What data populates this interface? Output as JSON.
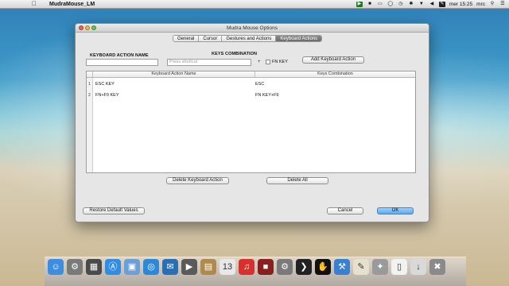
{
  "menubar": {
    "apple": "",
    "app_name": "MudraMouse_LM",
    "clock": "mer 15:25",
    "user": "mrc"
  },
  "window": {
    "title": "Mudra Mouse Options",
    "tabs": [
      {
        "label": "General",
        "active": false
      },
      {
        "label": "Cursor",
        "active": false
      },
      {
        "label": "Gestures and Actions",
        "active": false
      },
      {
        "label": "Keyboard Actions",
        "active": true
      }
    ],
    "keyboard_action_name_label": "KEYBOARD ACTION NAME",
    "keys_combination_label": "KEYS COMBINATION",
    "shortcut_placeholder": "Press shortcut",
    "plus": "+",
    "fn_key_label": "FN KEY",
    "add_button": "Add Keyboard Action",
    "table": {
      "columns": [
        "Keyboard Action Name",
        "Keys Combination"
      ],
      "rows": [
        {
          "n": "1",
          "name": "ESC KEY",
          "keys": "ESC"
        },
        {
          "n": "2",
          "name": "FN+F9 KEY",
          "keys": "FN KEY+F9"
        }
      ]
    },
    "delete_button": "Delete Keyboard Action",
    "delete_all_button": "Delete All",
    "restore_button": "Restore Default Values",
    "cancel_button": "Cancel",
    "ok_button": "OK"
  },
  "dock": {
    "icons": [
      {
        "name": "finder-icon",
        "color": "#3d8ee0"
      },
      {
        "name": "launchpad-icon",
        "color": "#7a7a7a"
      },
      {
        "name": "mission-control-icon",
        "color": "#4a4a4a"
      },
      {
        "name": "app-store-icon",
        "color": "#2f8de4"
      },
      {
        "name": "preview-icon",
        "color": "#6aa0d8"
      },
      {
        "name": "safari-icon",
        "color": "#2c89d8"
      },
      {
        "name": "mail-icon",
        "color": "#2a6fb5"
      },
      {
        "name": "facetime-icon",
        "color": "#5a5a5a"
      },
      {
        "name": "contacts-icon",
        "color": "#b08a4a"
      },
      {
        "name": "calendar-icon",
        "color": "#e8e8e8"
      },
      {
        "name": "itunes-icon",
        "color": "#d8302f"
      },
      {
        "name": "photo-booth-icon",
        "color": "#8a1f1f"
      },
      {
        "name": "system-preferences-icon",
        "color": "#7a7a7a"
      },
      {
        "name": "terminal-icon",
        "color": "#222222"
      },
      {
        "name": "mudra-icon",
        "color": "#111111"
      },
      {
        "name": "xcode-icon",
        "color": "#3b7fd0"
      },
      {
        "name": "textedit-icon",
        "color": "#e6e0cf"
      },
      {
        "name": "script-icon",
        "color": "#9a9a9a"
      },
      {
        "name": "document-icon",
        "color": "#f2f2f2"
      },
      {
        "name": "downloads-icon",
        "color": "#d9d9d9"
      },
      {
        "name": "trash-icon",
        "color": "#8a8a8a"
      }
    ]
  }
}
